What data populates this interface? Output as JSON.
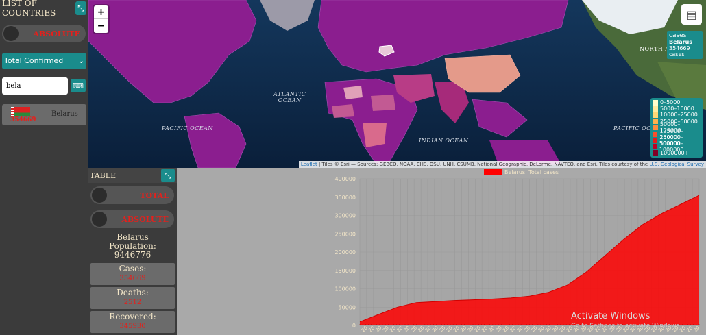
{
  "sidebar": {
    "title": "LIST OF COUNTRIES",
    "collapse_icon": "⤡",
    "toggle_label": "ABSOLUTE",
    "select_value": "Total Confirmed",
    "search_value": "bela",
    "keyboard_icon": "⌨",
    "country": {
      "name": "Belarus",
      "count": "354669"
    }
  },
  "map": {
    "zoom_in": "+",
    "zoom_out": "−",
    "tooltip": {
      "title": "cases",
      "country": "Belarus",
      "value": "354669 cases"
    },
    "oceans": {
      "atlantic_1": "ATLANTIC",
      "atlantic_2": "OCEAN",
      "pacific_left": "PACIFIC OCEAN",
      "pacific_right": "PACIFIC OCE",
      "indian": "INDIAN OCEAN",
      "north_am": "NORTH AM"
    },
    "legend": [
      {
        "label": "0–5000",
        "color": "#ffffcc"
      },
      {
        "label": "5000–10000",
        "color": "#ffeda0"
      },
      {
        "label": "10000–25000",
        "color": "#fed976"
      },
      {
        "label": "25000–50000",
        "color": "#feb24c"
      },
      {
        "label": "50000–125000",
        "color": "#fd8d3c"
      },
      {
        "label": "125000–250000",
        "color": "#fc4e2a"
      },
      {
        "label": "250000–500000",
        "color": "#e31a1c"
      },
      {
        "label": "500000–1000000",
        "color": "#bd0026"
      },
      {
        "label": "1000000+",
        "color": "#800026"
      }
    ],
    "attribution_link": "Leaflet",
    "attribution_text": " | Tiles © Esri — Sources: GEBCO, NOAA, CHS, OSU, UNH, CSUMB, National Geographic, DeLorme, NAVTEQ, and Esri, Tiles courtesy of the ",
    "attribution_link2": "U.S. Geological Survey"
  },
  "table_panel": {
    "title": "TABLE",
    "toggle_total": "TOTAL",
    "toggle_absolute": "ABSOLUTE",
    "country": "Belarus",
    "population_label": "Population:",
    "population": "9446776",
    "cases_label": "Cases:",
    "cases": "354669",
    "deaths_label": "Deaths:",
    "deaths": "2512",
    "recovered_label": "Recovered:",
    "recovered": "345930"
  },
  "watermark": {
    "line1": "Activate Windows",
    "line2": "Go to Settings to activate Windows."
  },
  "chart_data": {
    "type": "area",
    "legend": "Belarus: Total cases",
    "series_color": "#ff0000",
    "ylim": [
      0,
      400000
    ],
    "yticks": [
      0,
      50000,
      100000,
      150000,
      200000,
      250000,
      300000,
      350000,
      400000
    ],
    "x_tick_label": "20",
    "values": [
      10000,
      30000,
      50000,
      62000,
      65000,
      68000,
      70000,
      72000,
      75000,
      80000,
      90000,
      110000,
      145000,
      190000,
      235000,
      275000,
      305000,
      330000,
      355000
    ]
  }
}
